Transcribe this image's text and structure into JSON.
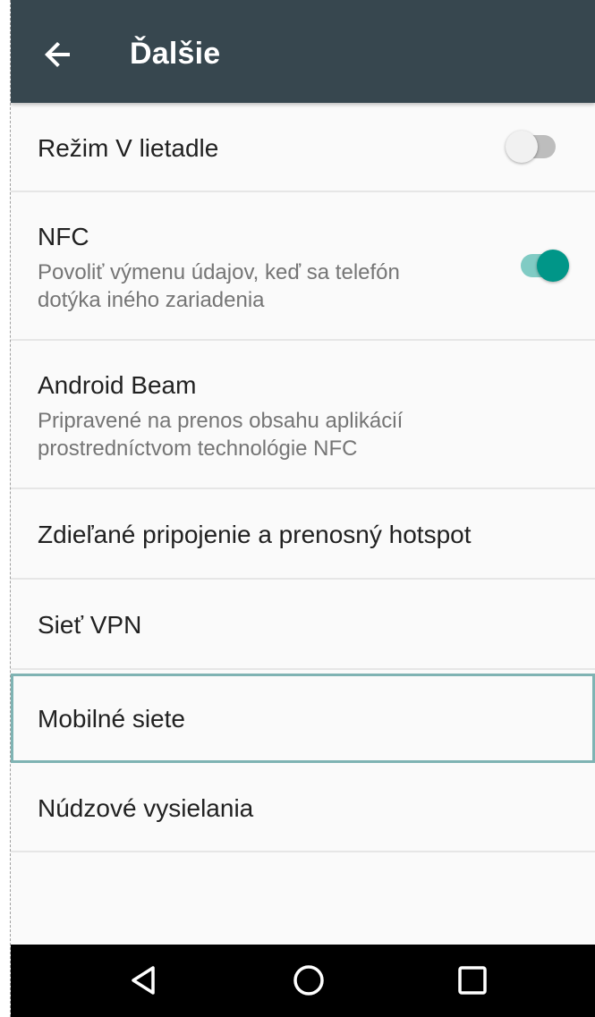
{
  "appbar": {
    "title": "Ďalšie",
    "back_icon": "arrow-back-icon",
    "background": "#37474f"
  },
  "settings": {
    "airplane": {
      "title": "Režim V lietadle",
      "toggle_on": false
    },
    "nfc": {
      "title": "NFC",
      "subtitle": "Povoliť výmenu údajov, keď sa telefón dotýka iného zariadenia",
      "toggle_on": true
    },
    "beam": {
      "title": "Android Beam",
      "subtitle": "Pripravené na prenos obsahu aplikácií prostredníctvom technológie NFC"
    },
    "tethering": {
      "title": "Zdieľané pripojenie a prenosný hotspot"
    },
    "vpn": {
      "title": "Sieť VPN"
    },
    "mobile": {
      "title": "Mobilné siete",
      "focused": true
    },
    "emergency": {
      "title": "Núdzové vysielania"
    }
  },
  "navbar": {
    "back_icon": "triangle-back-icon",
    "home_icon": "circle-home-icon",
    "recents_icon": "square-recents-icon"
  },
  "colors": {
    "accent": "#009688",
    "accent_track": "#80cbc4",
    "divider": "#e6e6e6",
    "focus_outline": "#7fb3b3"
  }
}
